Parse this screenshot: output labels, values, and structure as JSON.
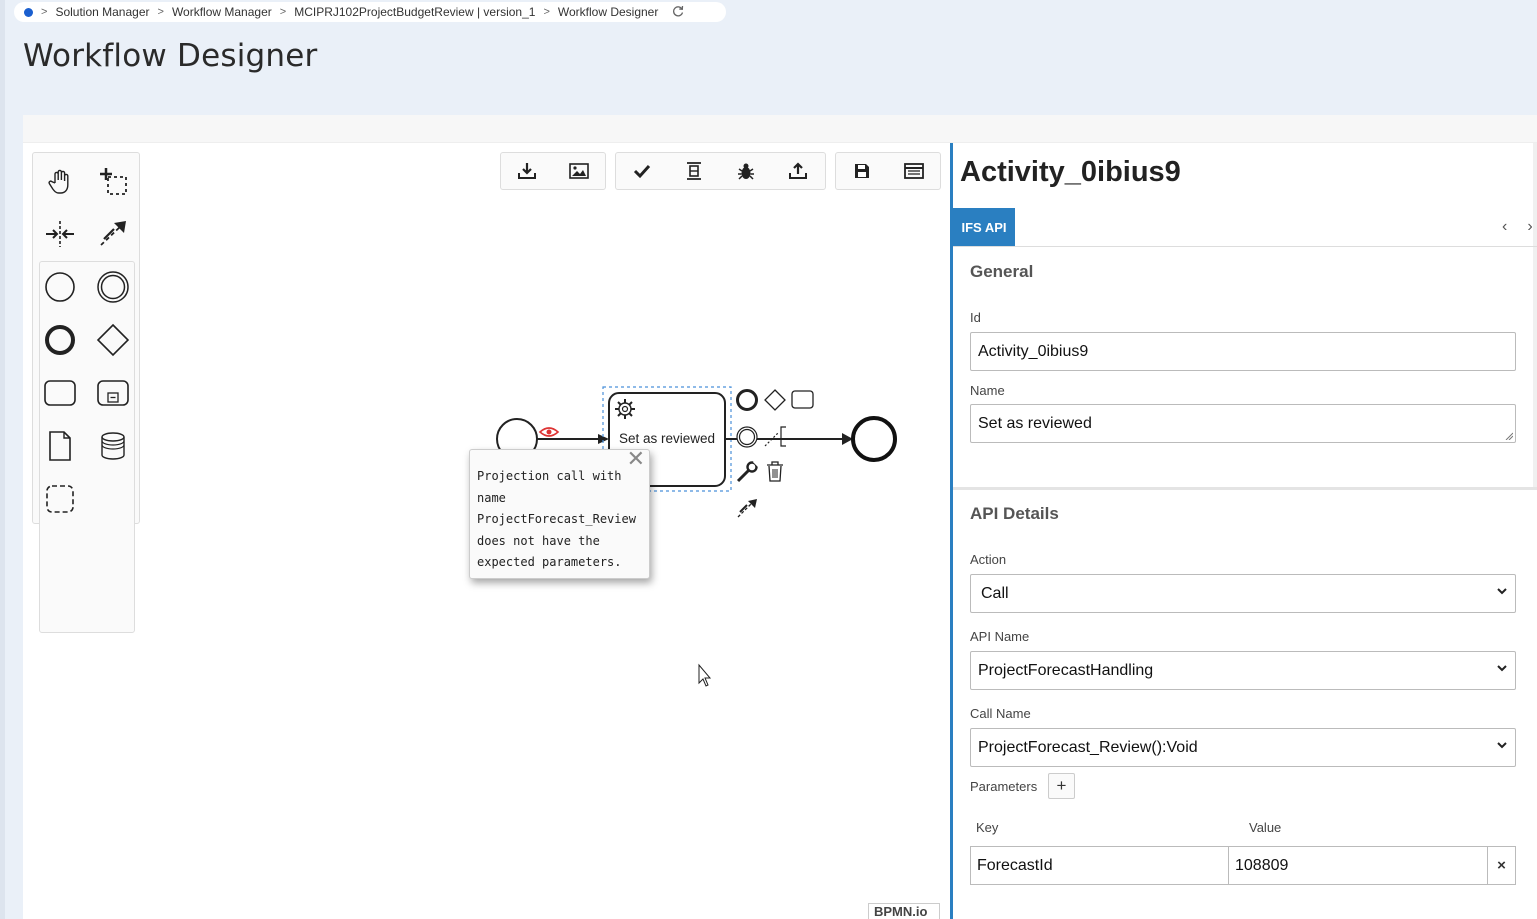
{
  "breadcrumb": {
    "items": [
      "Solution Manager",
      "Workflow Manager",
      "MCIPRJ102ProjectBudgetReview | version_1",
      "Workflow Designer"
    ]
  },
  "page": {
    "title": "Workflow Designer"
  },
  "palette": {
    "tools": [
      "hand-tool",
      "lasso-tool",
      "space-tool",
      "global-connect-tool",
      "start-event",
      "intermediate-event",
      "end-event",
      "gateway",
      "task",
      "subprocess",
      "data-object",
      "data-store",
      "group"
    ]
  },
  "toolbar": {
    "groups": [
      [
        "download-icon",
        "image-icon"
      ],
      [
        "check-icon",
        "align-icon",
        "bug-icon",
        "upload-icon"
      ],
      [
        "save-icon",
        "panel-icon"
      ]
    ]
  },
  "diagram": {
    "task_label": "Set as reviewed",
    "tooltip": {
      "lines": [
        "Projection call with",
        "name",
        "ProjectForecast_Review",
        "does not have the",
        "expected parameters."
      ],
      "close": "✕"
    },
    "watermark": "BPMN.io"
  },
  "properties": {
    "title": "Activity_0ibius9",
    "tab": "IFS API",
    "general": {
      "title": "General",
      "id_label": "Id",
      "id_value": "Activity_0ibius9",
      "name_label": "Name",
      "name_value": "Set as reviewed"
    },
    "api_details": {
      "title": "API Details",
      "action_label": "Action",
      "action_value": "Call",
      "api_name_label": "API Name",
      "api_name_value": "ProjectForecastHandling",
      "call_name_label": "Call Name",
      "call_name_value": "ProjectForecast_Review():Void",
      "parameters_label": "Parameters",
      "add_label": "+",
      "key_label": "Key",
      "value_label": "Value",
      "params": [
        {
          "key": "ForecastId",
          "value": "108809"
        }
      ],
      "remove_label": "×"
    }
  }
}
